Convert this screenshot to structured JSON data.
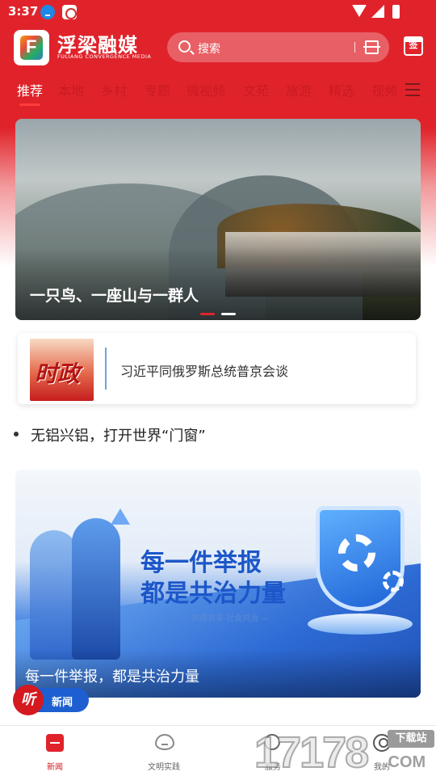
{
  "status_bar": {
    "time": "3:37"
  },
  "header": {
    "brand_name": "浮梁融媒",
    "brand_subtitle": "FULIANG CONVERGENCE MEDIA",
    "search_placeholder": "搜索",
    "sign_label": "签"
  },
  "tabs": [
    {
      "label": "推荐",
      "active": true
    },
    {
      "label": "本地"
    },
    {
      "label": "乡村"
    },
    {
      "label": "专题"
    },
    {
      "label": "微视频"
    },
    {
      "label": "文苑"
    },
    {
      "label": "旅游"
    },
    {
      "label": "精选"
    },
    {
      "label": "视频"
    }
  ],
  "banner": {
    "caption": "一只鸟、一座山与一群人"
  },
  "politics": {
    "badge": "时政",
    "headline": "习近平同俄罗斯总统普京会谈"
  },
  "headline_item": "无铝兴铝，打开世界“门窗”",
  "banner2": {
    "title_line1": "每一件举报",
    "title_line2": "都是共治力量",
    "subtitle": "— 共建共享  社会共治 —",
    "caption": "每一件举报，都是共治力量"
  },
  "listen_news": {
    "icon_char": "听",
    "label": "新闻"
  },
  "bottom_nav": [
    {
      "label": "新闻",
      "active": true
    },
    {
      "label": "文明实践"
    },
    {
      "label": "服务"
    },
    {
      "label": "我的"
    }
  ],
  "watermark": {
    "digits": "17178",
    "badge": "下载站",
    "domain": ".COM"
  },
  "colors": {
    "brand_red": "#e0232b",
    "accent_blue": "#1d5fd1"
  }
}
